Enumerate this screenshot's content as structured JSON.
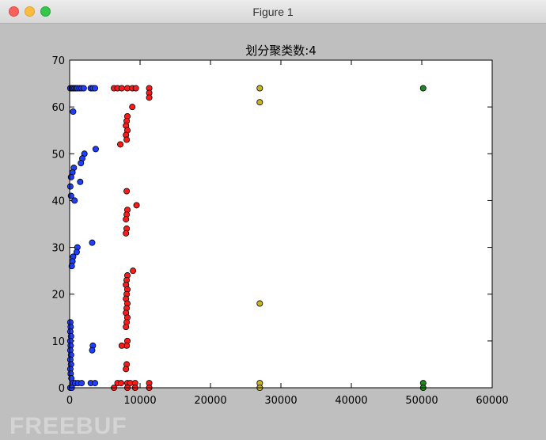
{
  "window": {
    "title": "Figure 1"
  },
  "watermark": "FREEBUF",
  "chart_data": {
    "type": "scatter",
    "title": "划分聚类数:4",
    "xlabel": "",
    "ylabel": "",
    "xlim": [
      0,
      60000
    ],
    "ylim": [
      0,
      70
    ],
    "xticks": [
      0,
      10000,
      20000,
      30000,
      40000,
      50000,
      60000
    ],
    "yticks": [
      0,
      10,
      20,
      30,
      40,
      50,
      60,
      70
    ],
    "grid": false,
    "series": [
      {
        "color": "#1f3fff",
        "points": [
          [
            100,
            64
          ],
          [
            300,
            64
          ],
          [
            500,
            64
          ],
          [
            700,
            64
          ],
          [
            900,
            64
          ],
          [
            1100,
            64
          ],
          [
            1400,
            64
          ],
          [
            1700,
            64
          ],
          [
            2000,
            64
          ],
          [
            3000,
            64
          ],
          [
            3300,
            64
          ],
          [
            3600,
            64
          ],
          [
            500,
            59
          ],
          [
            3700,
            51
          ],
          [
            2100,
            50
          ],
          [
            1800,
            49
          ],
          [
            1600,
            48
          ],
          [
            600,
            47
          ],
          [
            400,
            46
          ],
          [
            200,
            45
          ],
          [
            1500,
            44
          ],
          [
            100,
            43
          ],
          [
            200,
            41
          ],
          [
            700,
            40
          ],
          [
            3200,
            31
          ],
          [
            1100,
            30
          ],
          [
            1000,
            29
          ],
          [
            500,
            28
          ],
          [
            400,
            27
          ],
          [
            300,
            26
          ],
          [
            100,
            14
          ],
          [
            150,
            13
          ],
          [
            100,
            12
          ],
          [
            200,
            11
          ],
          [
            100,
            10
          ],
          [
            150,
            9
          ],
          [
            3300,
            9
          ],
          [
            3200,
            8
          ],
          [
            100,
            8
          ],
          [
            200,
            7
          ],
          [
            100,
            6
          ],
          [
            200,
            5
          ],
          [
            100,
            4
          ],
          [
            150,
            3
          ],
          [
            250,
            2
          ],
          [
            500,
            1
          ],
          [
            800,
            1
          ],
          [
            1200,
            1
          ],
          [
            1700,
            1
          ],
          [
            3000,
            1
          ],
          [
            3600,
            1
          ],
          [
            100,
            0
          ],
          [
            300,
            0
          ]
        ]
      },
      {
        "color": "#ff1a1a",
        "points": [
          [
            6300,
            64
          ],
          [
            6800,
            64
          ],
          [
            7400,
            64
          ],
          [
            8200,
            64
          ],
          [
            8900,
            64
          ],
          [
            9400,
            64
          ],
          [
            11300,
            64
          ],
          [
            11300,
            63
          ],
          [
            11300,
            62
          ],
          [
            8900,
            60
          ],
          [
            8200,
            58
          ],
          [
            8100,
            57
          ],
          [
            8000,
            56
          ],
          [
            8200,
            55
          ],
          [
            8000,
            54
          ],
          [
            8100,
            53
          ],
          [
            7200,
            52
          ],
          [
            8100,
            42
          ],
          [
            9500,
            39
          ],
          [
            8200,
            38
          ],
          [
            8100,
            37
          ],
          [
            8000,
            36
          ],
          [
            8100,
            34
          ],
          [
            8000,
            33
          ],
          [
            9000,
            25
          ],
          [
            8200,
            24
          ],
          [
            8100,
            23
          ],
          [
            8000,
            22
          ],
          [
            8200,
            21
          ],
          [
            8100,
            20
          ],
          [
            8000,
            19
          ],
          [
            8200,
            18
          ],
          [
            8100,
            17
          ],
          [
            8000,
            16
          ],
          [
            8200,
            15
          ],
          [
            8100,
            14
          ],
          [
            8000,
            13
          ],
          [
            8200,
            10
          ],
          [
            8100,
            9
          ],
          [
            7400,
            9
          ],
          [
            8100,
            5
          ],
          [
            8000,
            4
          ],
          [
            6800,
            1
          ],
          [
            7300,
            1
          ],
          [
            8200,
            1
          ],
          [
            8600,
            1
          ],
          [
            9300,
            1
          ],
          [
            11300,
            1
          ],
          [
            6300,
            0
          ],
          [
            8200,
            0
          ],
          [
            9300,
            0
          ],
          [
            11300,
            0
          ]
        ]
      },
      {
        "color": "#c8b41e",
        "points": [
          [
            27000,
            64
          ],
          [
            27000,
            61
          ],
          [
            27000,
            18
          ],
          [
            27000,
            1
          ],
          [
            27000,
            0
          ]
        ]
      },
      {
        "color": "#1d8a1d",
        "points": [
          [
            50200,
            64
          ],
          [
            50200,
            1
          ],
          [
            50200,
            0
          ]
        ]
      }
    ]
  }
}
